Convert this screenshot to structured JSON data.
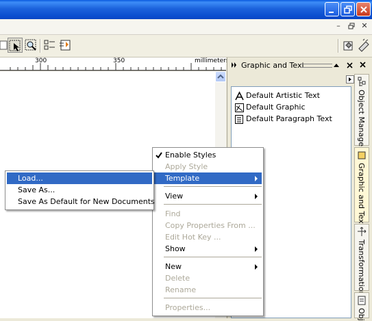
{
  "ruler": {
    "marks": [
      "300",
      "350"
    ],
    "units": "millimeters"
  },
  "docker": {
    "title": "Graphic and Text",
    "styles": [
      {
        "label": "Default Artistic Text",
        "icon": "artistic-text-icon"
      },
      {
        "label": "Default Graphic",
        "icon": "graphic-style-icon"
      },
      {
        "label": "Default Paragraph Text",
        "icon": "paragraph-text-icon"
      }
    ],
    "tabs": [
      "Object Manager",
      "Graphic and Text",
      "Transformation",
      "Obj"
    ]
  },
  "context_menu": {
    "items": [
      {
        "label": "Enable Styles",
        "checked": true,
        "enabled": true
      },
      {
        "label": "Apply Style",
        "enabled": false
      },
      {
        "label": "Template",
        "enabled": true,
        "submenu": true,
        "highlighted": true
      },
      {
        "label": "View",
        "enabled": true,
        "submenu": true
      },
      {
        "label": "Find",
        "enabled": false
      },
      {
        "label": "Copy Properties From ...",
        "enabled": false
      },
      {
        "label": "Edit Hot Key ...",
        "enabled": false
      },
      {
        "label": "Show",
        "enabled": true,
        "submenu": true
      },
      {
        "label": "New",
        "enabled": true,
        "submenu": true
      },
      {
        "label": "Delete",
        "enabled": false
      },
      {
        "label": "Rename",
        "enabled": false
      },
      {
        "label": "Properties...",
        "enabled": false
      }
    ]
  },
  "template_submenu": {
    "items": [
      {
        "label": "Load...",
        "highlighted": true
      },
      {
        "label": "Save As..."
      },
      {
        "label": "Save As Default for New Documents"
      }
    ]
  },
  "colors": {
    "highlight": "#316ac5",
    "titlebar": "#0a5ade",
    "disabled": "#aca899"
  }
}
